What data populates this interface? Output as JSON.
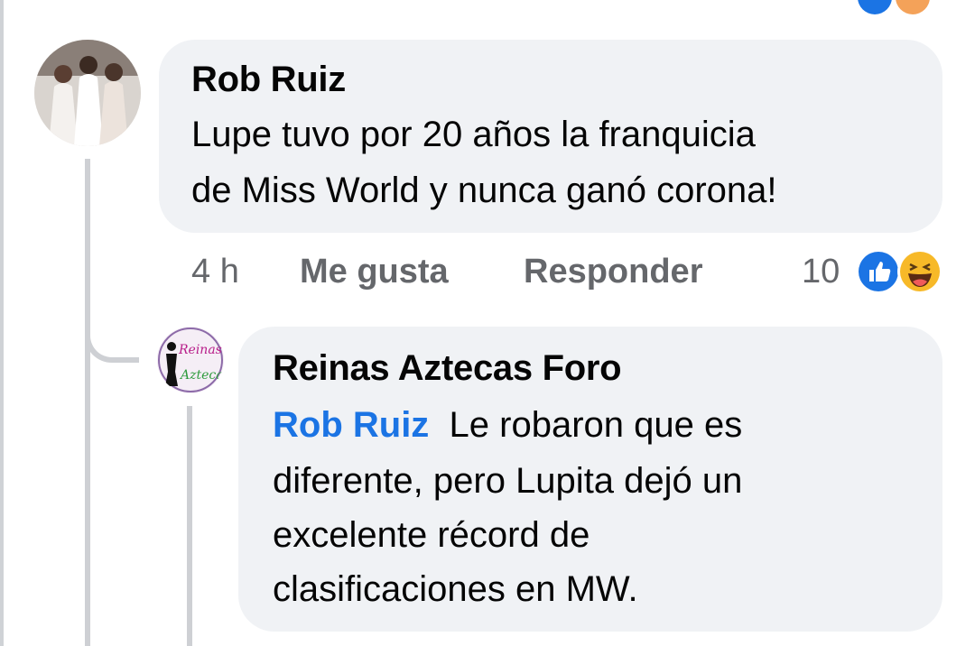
{
  "comment": {
    "author": "Rob Ruiz",
    "text_line1": "Lupe tuvo por 20 años la franquicia",
    "text_line2": "de Miss World y nunca ganó corona!",
    "time": "4 h",
    "like_label": "Me gusta",
    "reply_label": "Responder",
    "reaction_count": "10",
    "reactions": [
      "like-icon",
      "haha-icon"
    ]
  },
  "reply": {
    "author": "Reinas Aztecas Foro",
    "mention": "Rob Ruiz",
    "text_line1": "Le robaron que es",
    "text_line2": "diferente, pero Lupita dejó un",
    "text_line3": "excelente récord de",
    "text_line4": "clasificaciones en MW.",
    "avatar_text": "Reinas Aztecas"
  },
  "colors": {
    "bubble": "#f0f2f5",
    "mention": "#1b74e4",
    "meta": "#65676b",
    "like_blue": "#1b74e4",
    "haha_yellow": "#f7b928"
  }
}
